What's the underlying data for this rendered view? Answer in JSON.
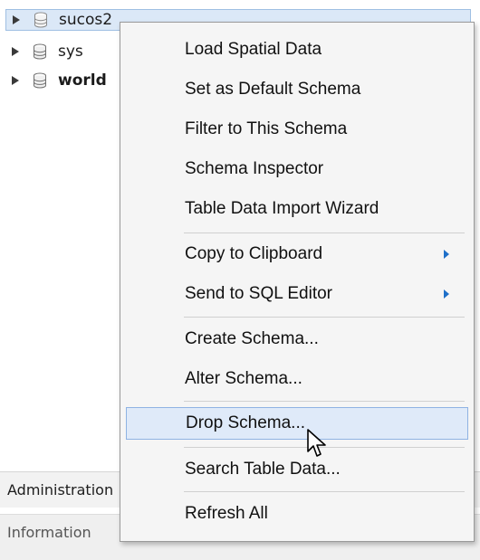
{
  "tree": {
    "rows": [
      {
        "label": "sucos2",
        "selected": true,
        "bold": false
      },
      {
        "label": "sys",
        "selected": false,
        "bold": false
      },
      {
        "label": "world",
        "selected": false,
        "bold": true
      }
    ]
  },
  "context_menu": {
    "items": [
      {
        "label": "Load Spatial Data",
        "has_submenu": false
      },
      {
        "label": "Set as Default Schema",
        "has_submenu": false
      },
      {
        "label": "Filter to This Schema",
        "has_submenu": false
      },
      {
        "label": "Schema Inspector",
        "has_submenu": false
      },
      {
        "label": "Table Data Import Wizard",
        "has_submenu": false
      },
      {
        "label": "Copy to Clipboard",
        "has_submenu": true
      },
      {
        "label": "Send to SQL Editor",
        "has_submenu": true
      },
      {
        "label": "Create Schema...",
        "has_submenu": false
      },
      {
        "label": "Alter Schema...",
        "has_submenu": false
      },
      {
        "label": "Drop Schema...",
        "has_submenu": false,
        "highlighted": true
      },
      {
        "label": "Search Table Data...",
        "has_submenu": false
      },
      {
        "label": "Refresh All",
        "has_submenu": false
      }
    ]
  },
  "bottom_tabs": {
    "administration": "Administration",
    "information": "Information"
  },
  "colors": {
    "selection_bg": "#dbe8f7",
    "menu_highlight_bg": "#dfeaf9",
    "menu_highlight_border": "#8fb3e3",
    "submenu_arrow": "#1e6fc8"
  }
}
